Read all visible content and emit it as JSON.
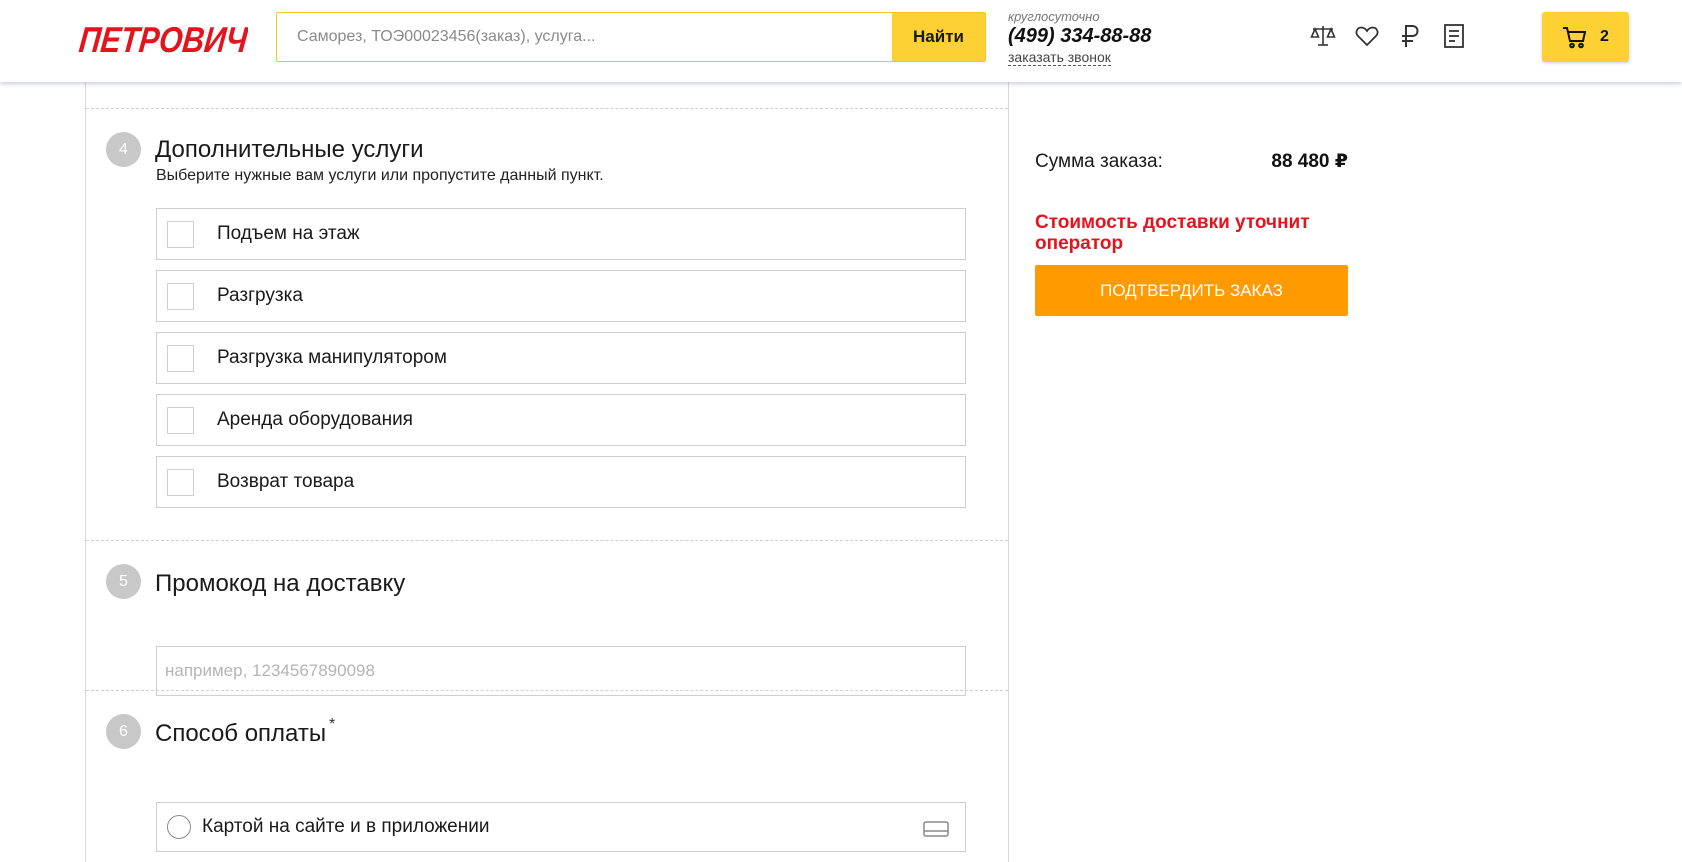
{
  "header": {
    "logo_text": "ПЕТРОВИЧ",
    "search": {
      "placeholder": "Саморез, ТОЭ00023456(заказ), услуга...",
      "button_label": "Найти"
    },
    "contacts": {
      "hours": "круглосуточно",
      "phone": "(499) 334-88-88",
      "callback_label": "заказать звонок"
    },
    "icons": [
      "scales-icon",
      "heart-icon",
      "ruble-icon",
      "document-icon"
    ],
    "cart": {
      "count": "2"
    }
  },
  "steps": {
    "services": {
      "number": "4",
      "title": "Дополнительные услуги",
      "subtitle": "Выберите нужные вам услуги или пропустите данный пункт.",
      "options": [
        {
          "label": "Подъем на этаж",
          "checked": false
        },
        {
          "label": "Разгрузка",
          "checked": false
        },
        {
          "label": "Разгрузка манипулятором",
          "checked": false
        },
        {
          "label": "Аренда оборудования",
          "checked": false
        },
        {
          "label": "Возврат товара",
          "checked": false
        }
      ]
    },
    "promo": {
      "number": "5",
      "title": "Промокод на доставку",
      "placeholder": "например, 1234567890098"
    },
    "payment": {
      "number": "6",
      "title": "Способ оплаты",
      "required_mark": "*",
      "options": [
        {
          "label": "Картой на сайте и в приложении",
          "selected": false,
          "icon": "card-icon"
        }
      ]
    }
  },
  "summary": {
    "total_label": "Сумма заказа:",
    "total_value": "88 480 ₽",
    "delivery_note": "Стоимость доставки уточнит оператор",
    "confirm_label": "ПОДТВЕРДИТЬ ЗАКАЗ"
  },
  "colors": {
    "brand_red": "#e3141e",
    "accent_yellow": "#fdd133",
    "confirm_orange": "#ff9a00"
  }
}
